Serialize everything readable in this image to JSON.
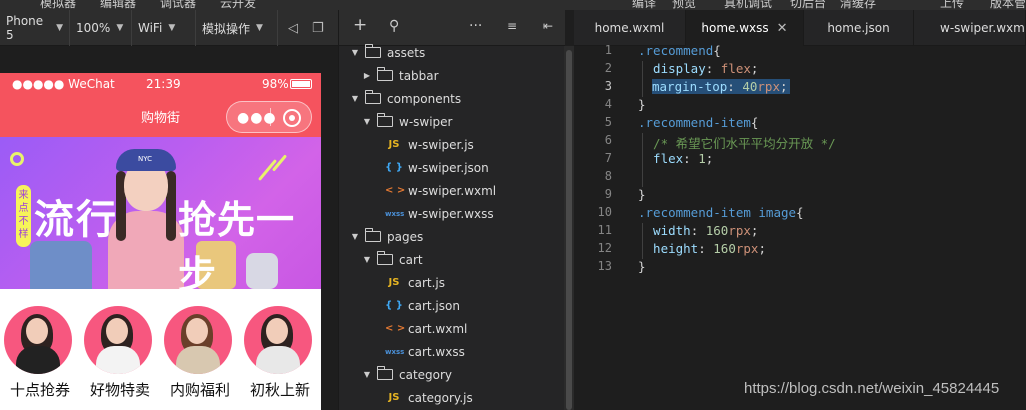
{
  "menubar": {
    "items": [
      "模拟器",
      "编辑器",
      "调试器",
      "云开发",
      "编译",
      "预览",
      "真机调试",
      "切后台",
      "清缓存",
      "上传",
      "版本管"
    ]
  },
  "simulator_toolbar": {
    "device": "Phone 5",
    "zoom": "100%",
    "network": "WiFi",
    "action": "模拟操作"
  },
  "phone": {
    "status": {
      "carrier": "●●●●● WeChat",
      "time": "21:39",
      "battery": "98%"
    },
    "nav_title": "购物街",
    "banner": {
      "tag": "来点不样",
      "headline_left": "流行",
      "headline_right": "抢先一步",
      "hat_text": "NYC"
    },
    "recommend": [
      {
        "label": "十点抢券"
      },
      {
        "label": "好物特卖"
      },
      {
        "label": "内购福利"
      },
      {
        "label": "初秋上新"
      }
    ]
  },
  "explorer": {
    "tree": [
      {
        "type": "folder",
        "name": "assets",
        "depth": 0,
        "open": true
      },
      {
        "type": "folder",
        "name": "tabbar",
        "depth": 1,
        "open": false
      },
      {
        "type": "folder",
        "name": "components",
        "depth": 0,
        "open": true
      },
      {
        "type": "folder",
        "name": "w-swiper",
        "depth": 1,
        "open": true
      },
      {
        "type": "file",
        "ext": "js",
        "name": "w-swiper.js",
        "depth": 2
      },
      {
        "type": "file",
        "ext": "json",
        "name": "w-swiper.json",
        "depth": 2
      },
      {
        "type": "file",
        "ext": "wxml",
        "name": "w-swiper.wxml",
        "depth": 2
      },
      {
        "type": "file",
        "ext": "wxss",
        "name": "w-swiper.wxss",
        "depth": 2
      },
      {
        "type": "folder",
        "name": "pages",
        "depth": 0,
        "open": true
      },
      {
        "type": "folder",
        "name": "cart",
        "depth": 1,
        "open": true
      },
      {
        "type": "file",
        "ext": "js",
        "name": "cart.js",
        "depth": 2
      },
      {
        "type": "file",
        "ext": "json",
        "name": "cart.json",
        "depth": 2
      },
      {
        "type": "file",
        "ext": "wxml",
        "name": "cart.wxml",
        "depth": 2
      },
      {
        "type": "file",
        "ext": "wxss",
        "name": "cart.wxss",
        "depth": 2
      },
      {
        "type": "folder",
        "name": "category",
        "depth": 1,
        "open": true
      },
      {
        "type": "file",
        "ext": "js",
        "name": "category.js",
        "depth": 2
      }
    ],
    "file_icons": {
      "js": "JS",
      "json": "{ }",
      "wxml": "< >",
      "wxss": "wxss"
    }
  },
  "editor": {
    "tabs": [
      {
        "label": "home.wxml",
        "active": false
      },
      {
        "label": "home.wxss",
        "active": true
      },
      {
        "label": "home.json",
        "active": false
      },
      {
        "label": "w-swiper.wxml",
        "active": false
      }
    ],
    "active_line": 3,
    "lines": [
      [
        {
          "t": ".recommend",
          "c": "class"
        },
        {
          "t": "{",
          "c": "brace"
        }
      ],
      [
        {
          "t": "  display",
          "c": "prop"
        },
        {
          "t": ": ",
          "c": "brace"
        },
        {
          "t": "flex",
          "c": "val"
        },
        {
          "t": ";",
          "c": "brace"
        }
      ],
      [
        {
          "t": "  margin-top",
          "c": "prop"
        },
        {
          "t": ": ",
          "c": "brace"
        },
        {
          "t": "40",
          "c": "num"
        },
        {
          "t": "rpx",
          "c": "unit"
        },
        {
          "t": ";",
          "c": "brace"
        }
      ],
      [
        {
          "t": "}",
          "c": "brace"
        }
      ],
      [
        {
          "t": ".recommend-item",
          "c": "class"
        },
        {
          "t": "{",
          "c": "brace"
        }
      ],
      [
        {
          "t": "  /* 希望它们水平平均分开放 */",
          "c": "cmt"
        }
      ],
      [
        {
          "t": "  flex",
          "c": "prop"
        },
        {
          "t": ": ",
          "c": "brace"
        },
        {
          "t": "1",
          "c": "num"
        },
        {
          "t": ";",
          "c": "brace"
        }
      ],
      [],
      [
        {
          "t": "}",
          "c": "brace"
        }
      ],
      [
        {
          "t": ".recommend-item image",
          "c": "class"
        },
        {
          "t": "{",
          "c": "brace"
        }
      ],
      [
        {
          "t": "  width",
          "c": "prop"
        },
        {
          "t": ": ",
          "c": "brace"
        },
        {
          "t": "160",
          "c": "num"
        },
        {
          "t": "rpx",
          "c": "unit"
        },
        {
          "t": ";",
          "c": "brace"
        }
      ],
      [
        {
          "t": "  height",
          "c": "prop"
        },
        {
          "t": ": ",
          "c": "brace"
        },
        {
          "t": "160",
          "c": "num"
        },
        {
          "t": "rpx",
          "c": "unit"
        },
        {
          "t": ";",
          "c": "brace"
        }
      ],
      [
        {
          "t": "}",
          "c": "brace"
        }
      ]
    ]
  },
  "watermark": "https://blog.csdn.net/weixin_45824445"
}
